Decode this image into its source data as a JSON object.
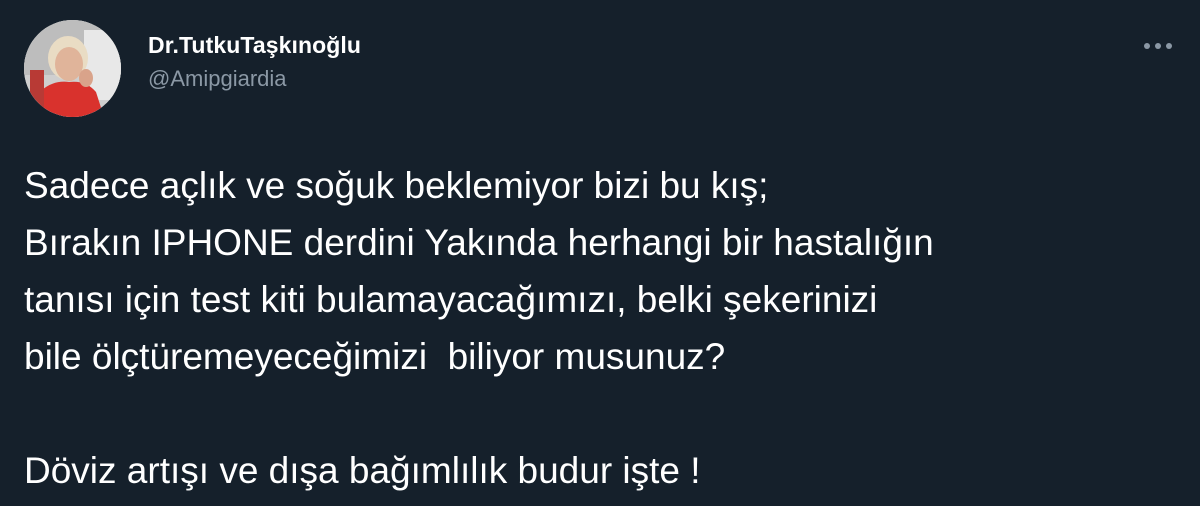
{
  "background": "#15202b",
  "author": {
    "display_name": "Dr.TutkuTaşkınoğlu",
    "handle": "@Amipgiardia",
    "avatar_icon": "profile-photo"
  },
  "more_icon": "more-options-icon",
  "tweet": {
    "lines": [
      "Sadece açlık ve soğuk beklemiyor bizi bu kış;",
      "Bırakın IPHONE derdini Yakında herhangi bir hastalığın",
      "tanısı için test kiti bulamayacağımızı, belki şekerinizi",
      "bile ölçtüremeyeceğimizi  biliyor musunuz?",
      "",
      "Döviz artışı ve dışa bağımlılık budur işte !"
    ]
  },
  "colors": {
    "text": "#ffffff",
    "secondary_text": "#8b98a5"
  }
}
